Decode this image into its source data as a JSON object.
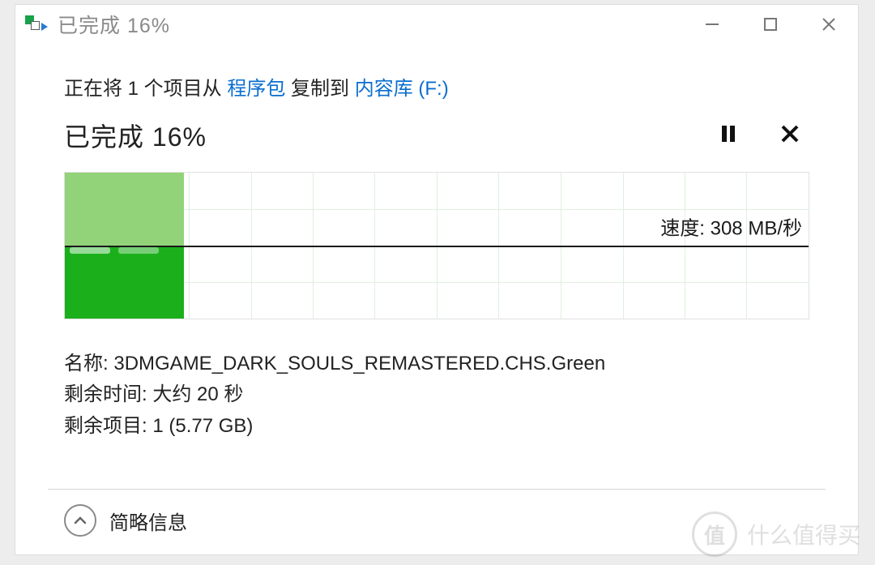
{
  "window": {
    "title": "已完成 16%"
  },
  "copy": {
    "prefix": "正在将 1 个项目从 ",
    "source": "程序包",
    "middle": " 复制到 ",
    "dest": "内容库 (F:)"
  },
  "status": "已完成 16%",
  "speed": {
    "label": "速度: ",
    "value": "308 MB/秒"
  },
  "chart_data": {
    "type": "area",
    "progress_percent": 16,
    "speed_mb_per_sec": 308,
    "title": "",
    "ylabel": "速度",
    "xlabel": ""
  },
  "details": {
    "name_label": "名称: ",
    "name_value": "3DMGAME_DARK_SOULS_REMASTERED.CHS.Green",
    "time_label": "剩余时间: ",
    "time_value": "大约 20 秒",
    "items_label": "剩余项目: ",
    "items_value": "1 (5.77 GB)"
  },
  "footer": {
    "brief_info": "简略信息"
  },
  "watermark": {
    "badge": "值",
    "text": "什么值得买"
  }
}
